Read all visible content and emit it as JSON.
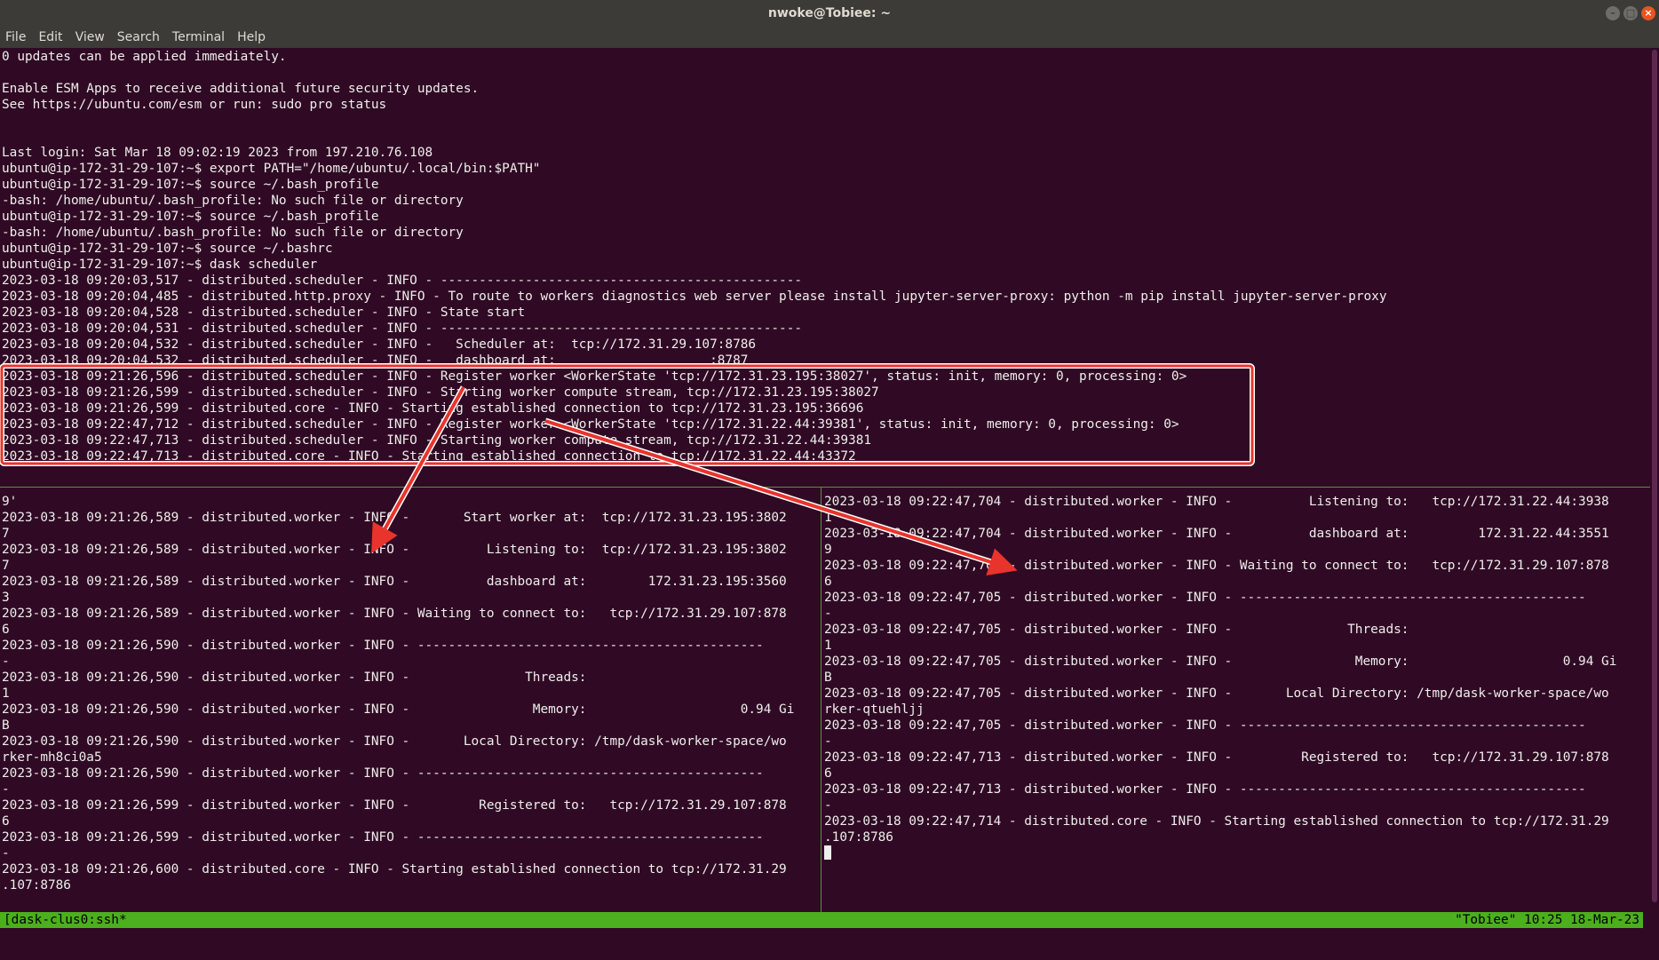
{
  "window": {
    "title": "nwoke@Tobiee: ~",
    "controls": [
      "–",
      "□",
      "×"
    ]
  },
  "menu": [
    "File",
    "Edit",
    "View",
    "Search",
    "Terminal",
    "Help"
  ],
  "top_pane": [
    "0 updates can be applied immediately.",
    "",
    "Enable ESM Apps to receive additional future security updates.",
    "See https://ubuntu.com/esm or run: sudo pro status",
    "",
    "",
    "Last login: Sat Mar 18 09:02:19 2023 from 197.210.76.108",
    "ubuntu@ip-172-31-29-107:~$ export PATH=\"/home/ubuntu/.local/bin:$PATH\"",
    "ubuntu@ip-172-31-29-107:~$ source ~/.bash_profile",
    "-bash: /home/ubuntu/.bash_profile: No such file or directory",
    "ubuntu@ip-172-31-29-107:~$ source ~/.bash_profile",
    "-bash: /home/ubuntu/.bash_profile: No such file or directory",
    "ubuntu@ip-172-31-29-107:~$ source ~/.bashrc",
    "ubuntu@ip-172-31-29-107:~$ dask scheduler",
    "2023-03-18 09:20:03,517 - distributed.scheduler - INFO - -----------------------------------------------",
    "2023-03-18 09:20:04,485 - distributed.http.proxy - INFO - To route to workers diagnostics web server please install jupyter-server-proxy: python -m pip install jupyter-server-proxy",
    "2023-03-18 09:20:04,528 - distributed.scheduler - INFO - State start",
    "2023-03-18 09:20:04,531 - distributed.scheduler - INFO - -----------------------------------------------",
    "2023-03-18 09:20:04,532 - distributed.scheduler - INFO -   Scheduler at:  tcp://172.31.29.107:8786",
    "2023-03-18 09:20:04,532 - distributed.scheduler - INFO -   dashboard at:                    :8787",
    "2023-03-18 09:21:26,596 - distributed.scheduler - INFO - Register worker <WorkerState 'tcp://172.31.23.195:38027', status: init, memory: 0, processing: 0>",
    "2023-03-18 09:21:26,599 - distributed.scheduler - INFO - Starting worker compute stream, tcp://172.31.23.195:38027",
    "2023-03-18 09:21:26,599 - distributed.core - INFO - Starting established connection to tcp://172.31.23.195:36696",
    "2023-03-18 09:22:47,712 - distributed.scheduler - INFO - Register worker <WorkerState 'tcp://172.31.22.44:39381', status: init, memory: 0, processing: 0>",
    "2023-03-18 09:22:47,713 - distributed.scheduler - INFO - Starting worker compute stream, tcp://172.31.22.44:39381",
    "2023-03-18 09:22:47,713 - distributed.core - INFO - Starting established connection to tcp://172.31.22.44:43372"
  ],
  "left_pane": [
    "9'",
    "2023-03-18 09:21:26,589 - distributed.worker - INFO -       Start worker at:  tcp://172.31.23.195:3802",
    "7",
    "2023-03-18 09:21:26,589 - distributed.worker - INFO -          Listening to:  tcp://172.31.23.195:3802",
    "7",
    "2023-03-18 09:21:26,589 - distributed.worker - INFO -          dashboard at:        172.31.23.195:3560",
    "3",
    "2023-03-18 09:21:26,589 - distributed.worker - INFO - Waiting to connect to:   tcp://172.31.29.107:878",
    "6",
    "2023-03-18 09:21:26,590 - distributed.worker - INFO - ---------------------------------------------",
    "-",
    "2023-03-18 09:21:26,590 - distributed.worker - INFO -               Threads:",
    "1",
    "2023-03-18 09:21:26,590 - distributed.worker - INFO -                Memory:                    0.94 Gi",
    "B",
    "2023-03-18 09:21:26,590 - distributed.worker - INFO -       Local Directory: /tmp/dask-worker-space/wo",
    "rker-mh8ci0a5",
    "2023-03-18 09:21:26,590 - distributed.worker - INFO - ---------------------------------------------",
    "-",
    "2023-03-18 09:21:26,599 - distributed.worker - INFO -         Registered to:   tcp://172.31.29.107:878",
    "6",
    "2023-03-18 09:21:26,599 - distributed.worker - INFO - ---------------------------------------------",
    "-",
    "2023-03-18 09:21:26,600 - distributed.core - INFO - Starting established connection to tcp://172.31.29",
    ".107:8786"
  ],
  "right_pane": [
    "2023-03-18 09:22:47,704 - distributed.worker - INFO -          Listening to:   tcp://172.31.22.44:3938",
    "1",
    "2023-03-18 09:22:47,704 - distributed.worker - INFO -          dashboard at:         172.31.22.44:3551",
    "9",
    "2023-03-18 09:22:47,705 - distributed.worker - INFO - Waiting to connect to:   tcp://172.31.29.107:878",
    "6",
    "2023-03-18 09:22:47,705 - distributed.worker - INFO - ---------------------------------------------",
    "-",
    "2023-03-18 09:22:47,705 - distributed.worker - INFO -               Threads:",
    "1",
    "2023-03-18 09:22:47,705 - distributed.worker - INFO -                Memory:                    0.94 Gi",
    "B",
    "2023-03-18 09:22:47,705 - distributed.worker - INFO -       Local Directory: /tmp/dask-worker-space/wo",
    "rker-qtuehljj",
    "2023-03-18 09:22:47,705 - distributed.worker - INFO - ---------------------------------------------",
    "-",
    "2023-03-18 09:22:47,713 - distributed.worker - INFO -         Registered to:   tcp://172.31.29.107:878",
    "6",
    "2023-03-18 09:22:47,713 - distributed.worker - INFO - ---------------------------------------------",
    "-",
    "2023-03-18 09:22:47,714 - distributed.core - INFO - Starting established connection to tcp://172.31.29",
    ".107:8786"
  ],
  "status_bar": {
    "left": "[dask-clus0:ssh*",
    "right": "\"Tobiee\" 10:25 18-Mar-23"
  },
  "colors": {
    "terminal_bg": "#300a24",
    "terminal_fg": "#eeeeec",
    "title_bg": "#3c3b37",
    "status_bg": "#4caf1e",
    "annotation": "#e8342c"
  }
}
